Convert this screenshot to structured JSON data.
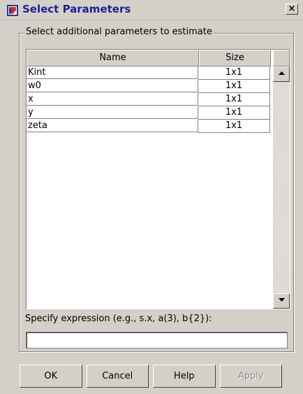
{
  "window": {
    "title": "Select Parameters",
    "close_symbol": "×"
  },
  "group": {
    "label": "Select additional parameters to estimate"
  },
  "table": {
    "headers": {
      "name": "Name",
      "size": "Size"
    },
    "rows": [
      {
        "name": "Kint",
        "size": "1x1"
      },
      {
        "name": "w0",
        "size": "1x1"
      },
      {
        "name": "x",
        "size": "1x1"
      },
      {
        "name": "y",
        "size": "1x1"
      },
      {
        "name": "zeta",
        "size": "1x1"
      }
    ]
  },
  "expression": {
    "label": "Specify expression (e.g., s.x, a(3), b{2}):",
    "value": ""
  },
  "buttons": {
    "ok": "OK",
    "cancel": "Cancel",
    "help": "Help",
    "apply": "Apply"
  },
  "icons": {
    "app": "simulink-icon",
    "close": "close-icon",
    "scroll_up": "scroll-up-arrow-icon",
    "scroll_down": "scroll-down-arrow-icon"
  },
  "colors": {
    "title_text": "#1f1f9a",
    "dialog_bg": "#d4d0c8",
    "disabled_text": "#8a8a8a"
  }
}
